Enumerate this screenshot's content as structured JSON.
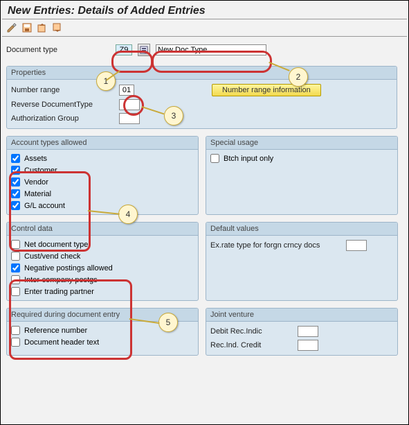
{
  "title": "New Entries: Details of Added Entries",
  "doc_type_label": "Document type",
  "doc_type_value": "Z9",
  "doc_type_desc": "New Doc Type",
  "properties": {
    "title": "Properties",
    "number_range_label": "Number range",
    "number_range_value": "01",
    "number_range_btn": "Number range information",
    "reverse_label": "Reverse DocumentType",
    "reverse_value": "",
    "auth_label": "Authorization Group",
    "auth_value": ""
  },
  "account_types": {
    "title": "Account types allowed",
    "items": [
      {
        "label": "Assets",
        "checked": true
      },
      {
        "label": "Customer",
        "checked": true
      },
      {
        "label": "Vendor",
        "checked": true
      },
      {
        "label": "Material",
        "checked": true
      },
      {
        "label": "G/L account",
        "checked": true
      }
    ]
  },
  "special_usage": {
    "title": "Special usage",
    "items": [
      {
        "label": "Btch input only",
        "checked": false
      }
    ]
  },
  "control_data": {
    "title": "Control data",
    "items": [
      {
        "label": "Net document type",
        "checked": false
      },
      {
        "label": "Cust/vend check",
        "checked": false
      },
      {
        "label": "Negative postings allowed",
        "checked": true
      },
      {
        "label": "Inter-company postgs",
        "checked": false
      },
      {
        "label": "Enter trading partner",
        "checked": false
      }
    ]
  },
  "default_values": {
    "title": "Default values",
    "ex_rate_label": "Ex.rate type for forgn crncy docs",
    "ex_rate_value": ""
  },
  "required_entry": {
    "title": "Required during document entry",
    "items": [
      {
        "label": "Reference number",
        "checked": false
      },
      {
        "label": "Document header text",
        "checked": false
      }
    ]
  },
  "joint_venture": {
    "title": "Joint venture",
    "debit_label": "Debit Rec.Indic",
    "debit_value": "",
    "credit_label": "Rec.Ind. Credit",
    "credit_value": ""
  },
  "callouts": {
    "1": "1",
    "2": "2",
    "3": "3",
    "4": "4",
    "5": "5"
  }
}
